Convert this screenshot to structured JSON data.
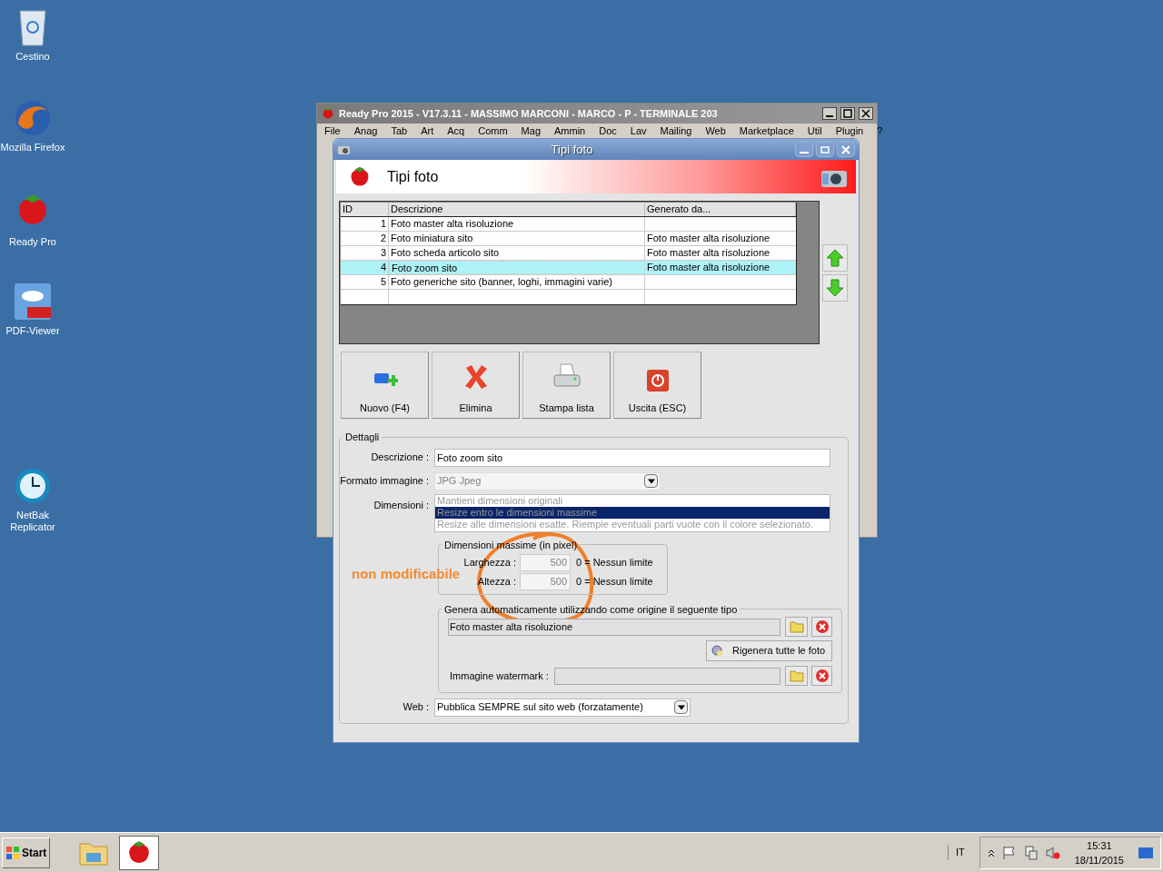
{
  "desktop_icons": [
    {
      "label": "Cestino",
      "kind": "trash"
    },
    {
      "label": "Mozilla Firefox",
      "kind": "browser"
    },
    {
      "label": "Ready Pro",
      "kind": "strawberry"
    },
    {
      "label": "PDF-Viewer",
      "kind": "pdf"
    },
    {
      "label": "NetBak Replicator",
      "kind": "clock"
    }
  ],
  "main_window": {
    "title": "Ready Pro 2015 - V17.3.11 - MASSIMO MARCONI - MARCO - P - TERMINALE 203",
    "menu": [
      "File",
      "Anag",
      "Tab",
      "Art",
      "Acq",
      "Comm",
      "Mag",
      "Ammin",
      "Doc",
      "Lav",
      "Mailing",
      "Web",
      "Marketplace",
      "Util",
      "Plugin",
      "?"
    ]
  },
  "dialog": {
    "title": "Tipi foto",
    "header": "Tipi foto",
    "table": {
      "columns": [
        "ID",
        "Descrizione",
        "Generato da..."
      ],
      "rows": [
        {
          "id": "1",
          "descrizione": "Foto master alta risoluzione",
          "selected": false
        },
        {
          "id": "2",
          "descrizione": "Foto miniatura sito",
          "generato_da": "Foto master alta risoluzione",
          "selected": false
        },
        {
          "id": "3",
          "descrizione": "Foto scheda articolo sito",
          "generato_da": "Foto master alta risoluzione",
          "selected": false
        },
        {
          "id": "4",
          "descrizione": "Foto zoom sito",
          "generato_da": "Foto master alta risoluzione",
          "selected": true
        },
        {
          "id": "5",
          "descrizione": "Foto generiche sito (banner, loghi, immagini varie)",
          "selected": false
        }
      ]
    },
    "toolbar": [
      {
        "label": "Nuovo (F4)",
        "kind": "new"
      },
      {
        "label": "Elimina",
        "kind": "delete"
      },
      {
        "label": "Stampa lista",
        "kind": "print"
      },
      {
        "label": "Uscita (ESC)",
        "kind": "exit"
      }
    ],
    "details": {
      "title": "Dettagli",
      "descrizione": {
        "label": "Descrizione :",
        "value": "Foto zoom sito"
      },
      "formato": {
        "label": "Formato immagine :",
        "value": "JPG Jpeg",
        "disabled": true
      },
      "dimensioni": {
        "label": "Dimensioni :",
        "disabled": true,
        "options": [
          {
            "label": "Mantieni dimensioni originali",
            "selected": false
          },
          {
            "label": "Resize entro le dimensioni massime",
            "selected": true
          },
          {
            "label": "Resize alle dimensioni esatte. Riempie eventuali parti vuote con il colore selezionato.",
            "selected": false
          }
        ]
      },
      "max_dims": {
        "title": "Dimensioni massime (in pixel)",
        "disabled": true,
        "fields": [
          {
            "label": "Larghezza :",
            "value": "500",
            "hint": "0 = Nessun limite"
          },
          {
            "label": "Altezza :",
            "value": "500",
            "hint": "0 = Nessun limite"
          }
        ]
      },
      "genera": {
        "title": "Genera automaticamente utilizzando come origine il seguente tipo",
        "value": "Foto master alta risoluzione",
        "regen_button": "Rigenera tutte le foto",
        "watermark_label": "Immagine watermark :"
      },
      "web": {
        "label": "Web :",
        "value": "Pubblica SEMPRE sul sito web (forzatamente)"
      }
    }
  },
  "annotation": {
    "text": "non modificabile"
  },
  "taskbar": {
    "start": "Start",
    "language": "IT",
    "time": "15:31",
    "date": "18/11/2015"
  }
}
